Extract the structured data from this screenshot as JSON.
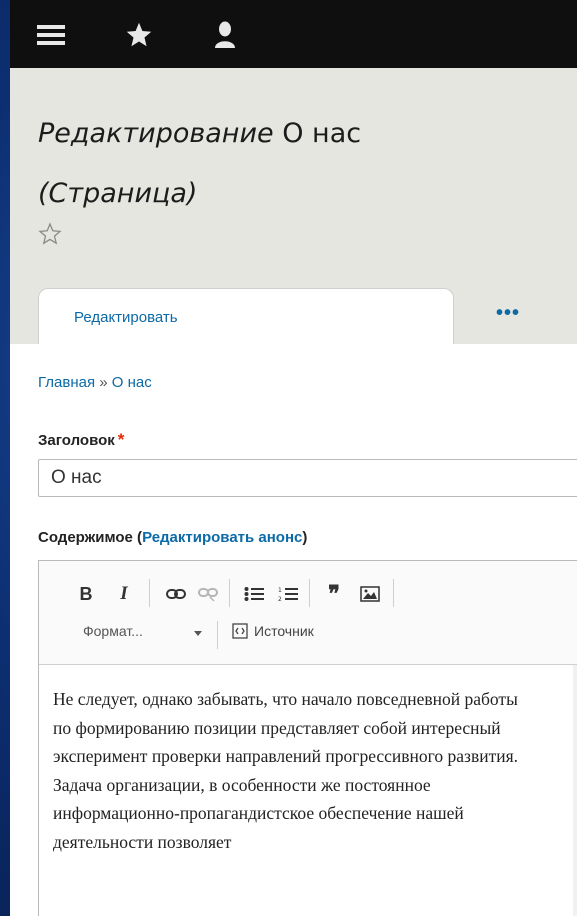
{
  "toolbar": {
    "icons": [
      "menu-icon",
      "star-icon",
      "user-icon"
    ]
  },
  "header": {
    "title_italic": "Редактирование",
    "title_rest": " О нас",
    "title_line2": "(Страница)",
    "favorite_icon": "star-outline-icon"
  },
  "tabs": {
    "edit_label": "Редактировать",
    "more_label": "•••"
  },
  "breadcrumb": {
    "home": "Главная",
    "separator": "»",
    "current": "О нас"
  },
  "form": {
    "title_label": "Заголовок",
    "required_mark": "*",
    "title_value": "О нас",
    "body_label": "Содержимое (",
    "body_link": "Редактировать анонс",
    "body_label_end": ")"
  },
  "editor": {
    "buttons": [
      "bold-button",
      "italic-button",
      "link-button",
      "unlink-button",
      "bullet-list-button",
      "numbered-list-button",
      "blockquote-button",
      "image-button"
    ],
    "bold_label": "B",
    "italic_label": "I",
    "quote_label": "❞",
    "format_label": "Формат...",
    "source_label": "Источник",
    "content": "Не следует, однако забывать, что начало повседневной работы по формированию позиции представляет собой интересный эксперимент проверки направлений прогрессивного развития. Задача организации, в особенности же постоянное информационно-пропагандистское обеспечение нашей деятельности позволяет"
  },
  "colors": {
    "toolbar_bg": "#0f0f0f",
    "header_bg": "#e6e6e1",
    "link": "#0c6aa6",
    "required": "#e62600"
  }
}
